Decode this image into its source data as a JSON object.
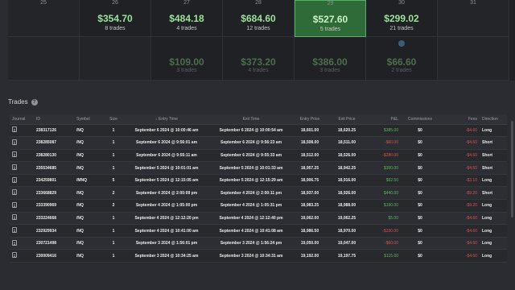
{
  "calendar": {
    "week1": [
      {
        "day": "25",
        "pnl": "",
        "trades": "",
        "style": "empty"
      },
      {
        "day": "26",
        "pnl": "$354.70",
        "trades": "8 trades",
        "style": "win"
      },
      {
        "day": "27",
        "pnl": "$484.18",
        "trades": "4 trades",
        "style": "win"
      },
      {
        "day": "28",
        "pnl": "$684.60",
        "trades": "12 trades",
        "style": "win"
      },
      {
        "day": "29",
        "pnl": "$527.60",
        "trades": "5 trades",
        "style": "highlight"
      },
      {
        "day": "30",
        "pnl": "$299.02",
        "trades": "21 trades",
        "style": "win"
      },
      {
        "day": "31",
        "pnl": "",
        "trades": "",
        "style": "empty"
      }
    ],
    "week2": [
      {
        "pnl": "",
        "trades": "",
        "style": "empty"
      },
      {
        "pnl": "",
        "trades": "",
        "style": "empty"
      },
      {
        "pnl": "$109.00",
        "trades": "3 trades",
        "style": "faded"
      },
      {
        "pnl": "$373.20",
        "trades": "4 trades",
        "style": "faded"
      },
      {
        "pnl": "$386.00",
        "trades": "3 trades",
        "style": "faded"
      },
      {
        "pnl": "$66.60",
        "trades": "2 trades",
        "style": "faded-dot"
      },
      {
        "pnl": "",
        "trades": "",
        "style": "empty"
      }
    ]
  },
  "trades_section": {
    "title": "Trades",
    "help_icon": "?"
  },
  "table": {
    "headers": [
      "Journal",
      "ID",
      "Symbol",
      "Size",
      "Entry Time",
      "Exit Time",
      "Entry Price",
      "Exit Price",
      "P&L",
      "Commissions",
      "Fees",
      "Direction"
    ],
    "sort_icon": "↓",
    "rows": [
      {
        "id": "238317126",
        "symbol": "/NQ",
        "size": "1",
        "entry_time": "September 6 2024 @ 10:00:46 am",
        "exit_time": "September 6 2024 @ 10:00:54 am",
        "entry_price": "18,601.00",
        "exit_price": "18,620.25",
        "pnl": "$385.00",
        "pnl_sign": "pos",
        "commissions": "$0",
        "fees": "-$4.60",
        "direction": "Long"
      },
      {
        "id": "238285087",
        "symbol": "/NQ",
        "size": "1",
        "entry_time": "September 6 2024 @ 9:56:01 am",
        "exit_time": "September 6 2024 @ 9:56:23 am",
        "entry_price": "18,508.00",
        "exit_price": "18,511.00",
        "pnl": "-$60.00",
        "pnl_sign": "neg",
        "commissions": "$0",
        "fees": "-$4.60",
        "direction": "Short"
      },
      {
        "id": "238280130",
        "symbol": "/NQ",
        "size": "1",
        "entry_time": "September 6 2024 @ 9:55:11 am",
        "exit_time": "September 6 2024 @ 9:55:33 am",
        "entry_price": "18,512.00",
        "exit_price": "18,526.00",
        "pnl": "-$280.00",
        "pnl_sign": "neg",
        "commissions": "$0",
        "fees": "-$4.60",
        "direction": "Short"
      },
      {
        "id": "235534685",
        "symbol": "/NQ",
        "size": "1",
        "entry_time": "September 5 2024 @ 10:01:01 am",
        "exit_time": "September 5 2024 @ 10:01:33 am",
        "entry_price": "18,957.25",
        "exit_price": "18,942.25",
        "pnl": "$300.00",
        "pnl_sign": "pos",
        "commissions": "$0",
        "fees": "-$4.60",
        "direction": "Short"
      },
      {
        "id": "234259801",
        "symbol": "/MNQ",
        "size": "5",
        "entry_time": "September 5 2024 @ 12:15:05 am",
        "exit_time": "September 5 2024 @ 12:15:29 am",
        "entry_price": "18,906.75",
        "exit_price": "18,916.00",
        "pnl": "$92.50",
        "pnl_sign": "pos",
        "commissions": "$0",
        "fees": "-$3.10",
        "direction": "Long"
      },
      {
        "id": "233668829",
        "symbol": "/NQ",
        "size": "2",
        "entry_time": "September 4 2024 @ 2:00:09 pm",
        "exit_time": "September 4 2024 @ 2:00:11 pm",
        "entry_price": "18,937.00",
        "exit_price": "18,926.00",
        "pnl": "$440.00",
        "pnl_sign": "pos",
        "commissions": "$0",
        "fees": "-$9.20",
        "direction": "Short"
      },
      {
        "id": "233390969",
        "symbol": "/NQ",
        "size": "2",
        "entry_time": "September 4 2024 @ 1:05:00 pm",
        "exit_time": "September 4 2024 @ 1:05:31 pm",
        "entry_price": "18,983.25",
        "exit_price": "18,988.00",
        "pnl": "$190.00",
        "pnl_sign": "pos",
        "commissions": "$0",
        "fees": "-$9.20",
        "direction": "Long"
      },
      {
        "id": "233224668",
        "symbol": "/NQ",
        "size": "1",
        "entry_time": "September 4 2024 @ 12:12:20 pm",
        "exit_time": "September 4 2024 @ 12:12:40 pm",
        "entry_price": "19,062.00",
        "exit_price": "19,062.25",
        "pnl": "$5.00",
        "pnl_sign": "pos",
        "commissions": "$0",
        "fees": "-$4.60",
        "direction": "Long"
      },
      {
        "id": "232929934",
        "symbol": "/NQ",
        "size": "1",
        "entry_time": "September 4 2024 @ 10:41:00 am",
        "exit_time": "September 4 2024 @ 10:41:08 am",
        "entry_price": "18,986.50",
        "exit_price": "18,970.00",
        "pnl": "-$330.00",
        "pnl_sign": "neg",
        "commissions": "$0",
        "fees": "-$4.60",
        "direction": "Long"
      },
      {
        "id": "230721498",
        "symbol": "/NQ",
        "size": "1",
        "entry_time": "September 3 2024 @ 1:56:01 pm",
        "exit_time": "September 3 2024 @ 1:56:24 pm",
        "entry_price": "19,050.00",
        "exit_price": "19,047.00",
        "pnl": "-$60.00",
        "pnl_sign": "neg",
        "commissions": "$0",
        "fees": "-$4.60",
        "direction": "Long"
      },
      {
        "id": "230009416",
        "symbol": "/NQ",
        "size": "1",
        "entry_time": "September 3 2024 @ 10:34:25 am",
        "exit_time": "September 3 2024 @ 10:34:31 am",
        "entry_price": "19,192.00",
        "exit_price": "19,197.75",
        "pnl": "$115.00",
        "pnl_sign": "pos",
        "commissions": "$0",
        "fees": "-$4.60",
        "direction": "Long"
      }
    ]
  },
  "colors": {
    "background": "#2a2c31",
    "win_text": "#9be29a",
    "highlight_cell": "#2e6b38",
    "positive": "#5cb85c",
    "negative": "#d9534f"
  }
}
